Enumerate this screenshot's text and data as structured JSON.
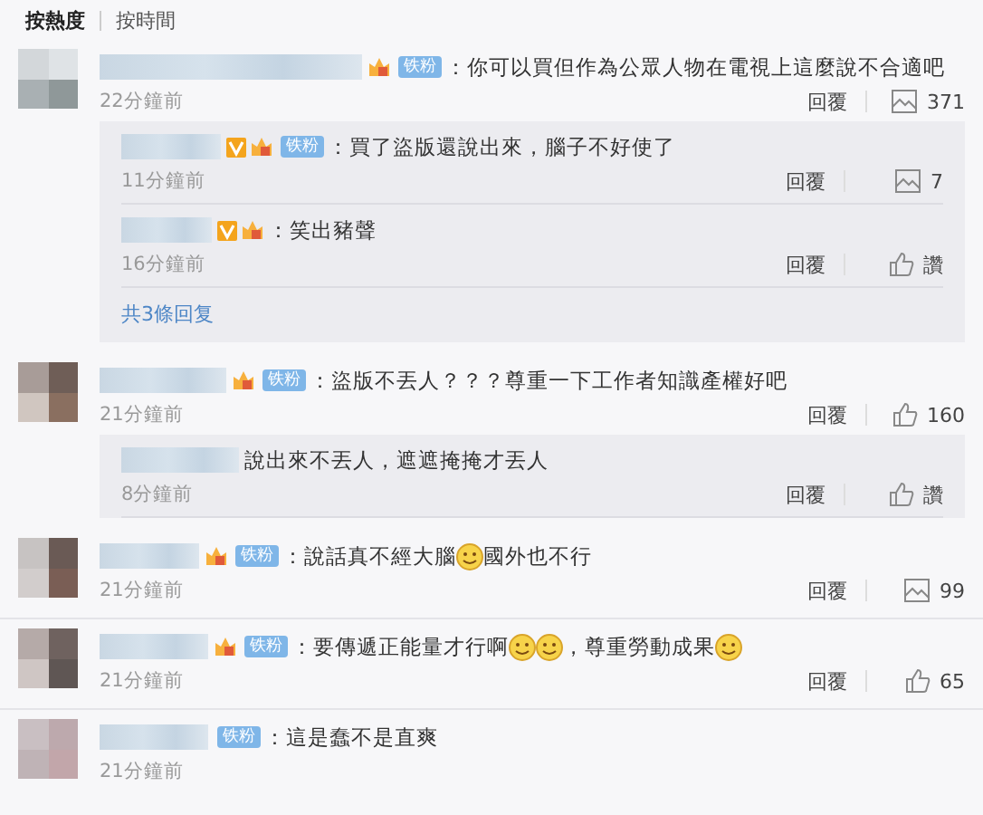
{
  "tabs": [
    {
      "label": "按熱度",
      "selected": true
    },
    {
      "label": "按時間",
      "selected": false
    }
  ],
  "comments": [
    {
      "badges": [
        {
          "kind": "fan"
        },
        {
          "kind": "tag",
          "text": "铁粉"
        }
      ],
      "content": [
        {
          "kind": "text",
          "text": "：你可以買但作為公眾人物在電視上這麼說不合適吧"
        }
      ],
      "time": "22分鐘前",
      "reply_label": "回覆",
      "like": {
        "kind": "picture",
        "count": "371"
      },
      "replies": [
        {
          "badges": [
            {
              "kind": "vip"
            },
            {
              "kind": "fan"
            },
            {
              "kind": "tag",
              "text": "铁粉"
            }
          ],
          "content": [
            {
              "kind": "text",
              "text": "：買了盜版還說出來，腦子不好使了"
            }
          ],
          "time": "11分鐘前",
          "reply_label": "回覆",
          "like": {
            "kind": "picture",
            "count": "7"
          }
        },
        {
          "badges": [
            {
              "kind": "vip"
            },
            {
              "kind": "fan"
            }
          ],
          "content": [
            {
              "kind": "text",
              "text": "：笑出豬聲"
            }
          ],
          "time": "16分鐘前",
          "reply_label": "回覆",
          "like": {
            "kind": "thumb",
            "count": "讚"
          }
        }
      ],
      "more": "共3條回复"
    },
    {
      "badges": [
        {
          "kind": "fan"
        },
        {
          "kind": "tag",
          "text": "铁粉"
        }
      ],
      "content": [
        {
          "kind": "text",
          "text": "：盜版不丟人？？？尊重一下工作者知識產權好吧"
        }
      ],
      "time": "21分鐘前",
      "reply_label": "回覆",
      "like": {
        "kind": "thumb",
        "count": "160"
      },
      "replies": [
        {
          "content": [
            {
              "kind": "text",
              "text": "說出來不丟人，遮遮掩掩才丟人"
            }
          ],
          "time": "8分鐘前",
          "reply_label": "回覆",
          "like": {
            "kind": "thumb",
            "count": "讚"
          }
        }
      ]
    },
    {
      "badges": [
        {
          "kind": "fan"
        },
        {
          "kind": "tag",
          "text": "铁粉"
        }
      ],
      "content": [
        {
          "kind": "text",
          "text": "：說話真不經大腦"
        },
        {
          "kind": "emoji"
        },
        {
          "kind": "text",
          "text": "國外也不行"
        }
      ],
      "time": "21分鐘前",
      "reply_label": "回覆",
      "like": {
        "kind": "picture",
        "count": "99"
      }
    },
    {
      "badges": [
        {
          "kind": "fan"
        },
        {
          "kind": "tag",
          "text": "铁粉"
        }
      ],
      "content": [
        {
          "kind": "text",
          "text": "：要傳遞正能量才行啊"
        },
        {
          "kind": "emoji"
        },
        {
          "kind": "emoji"
        },
        {
          "kind": "text",
          "text": "，尊重勞動成果"
        },
        {
          "kind": "emoji"
        }
      ],
      "time": "21分鐘前",
      "reply_label": "回覆",
      "like": {
        "kind": "thumb",
        "count": "65"
      }
    },
    {
      "badges": [
        {
          "kind": "tag",
          "text": "铁粉"
        }
      ],
      "content": [
        {
          "kind": "text",
          "text": "：這是蠢不是直爽"
        }
      ],
      "time": "21分鐘前"
    }
  ]
}
